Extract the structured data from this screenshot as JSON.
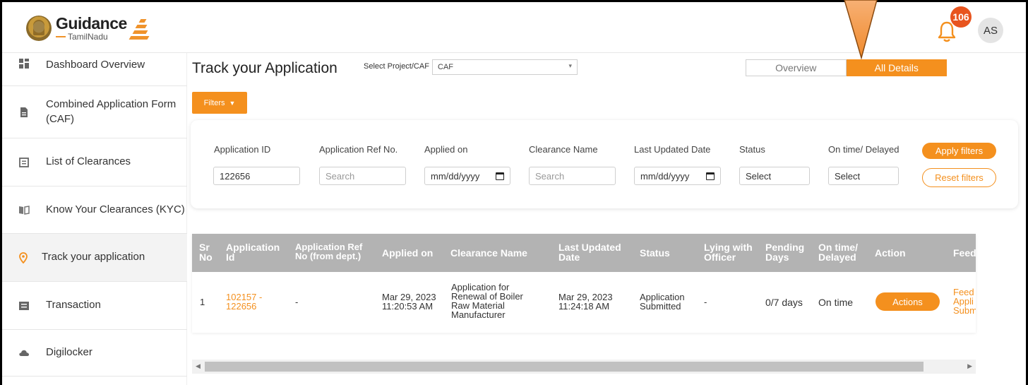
{
  "header": {
    "logo": {
      "title": "Guidance",
      "subtitle": "TamilNadu"
    },
    "notifications": {
      "count": "106"
    },
    "user": {
      "initials": "AS"
    }
  },
  "sidebar": {
    "items": [
      {
        "label": "Dashboard Overview",
        "icon": "dashboard-icon"
      },
      {
        "label": "Combined Application Form (CAF)",
        "icon": "document-icon"
      },
      {
        "label": "List of Clearances",
        "icon": "list-icon"
      },
      {
        "label": "Know Your Clearances (KYC)",
        "icon": "book-icon"
      },
      {
        "label": "Track your application",
        "icon": "location-pin-icon",
        "active": true
      },
      {
        "label": "Transaction",
        "icon": "transaction-icon"
      },
      {
        "label": "Digilocker",
        "icon": "cloud-icon"
      }
    ]
  },
  "main": {
    "title": "Track your Application",
    "project_label": "Select Project/CAF",
    "project_value": "CAF",
    "view_toggle": {
      "overview": "Overview",
      "all_details": "All Details",
      "selected": "All Details"
    },
    "filters_button": "Filters"
  },
  "filters": {
    "application_id": {
      "label": "Application ID",
      "value": "122656"
    },
    "application_ref": {
      "label": "Application Ref No.",
      "placeholder": "Search"
    },
    "applied_on": {
      "label": "Applied on",
      "placeholder": "mm/dd/yyyy"
    },
    "clearance_name": {
      "label": "Clearance Name",
      "placeholder": "Search"
    },
    "last_updated": {
      "label": "Last Updated Date",
      "placeholder": "mm/dd/yyyy"
    },
    "status": {
      "label": "Status",
      "value": "Select"
    },
    "ontime": {
      "label": "On time/ Delayed",
      "value": "Select"
    },
    "apply_label": "Apply filters",
    "reset_label": "Reset filters"
  },
  "table": {
    "headers": {
      "sr": [
        "Sr",
        "No"
      ],
      "app_id": [
        "Application",
        "Id"
      ],
      "ref": [
        "Application Ref",
        "No (from dept.)"
      ],
      "applied": "Applied on",
      "clearance": "Clearance Name",
      "updated": [
        "Last Updated",
        "Date"
      ],
      "status": "Status",
      "officer": [
        "Lying with",
        "Officer"
      ],
      "pending": [
        "Pending",
        "Days"
      ],
      "ontime": [
        "On time/",
        "Delayed"
      ],
      "action": "Action",
      "feedback": "Feed"
    },
    "row": {
      "sr": "1",
      "app_id": [
        "102157 -",
        "122656"
      ],
      "ref": "-",
      "applied": [
        "Mar 29, 2023",
        "11:20:53 AM"
      ],
      "clearance": [
        "Application for",
        "Renewal of Boiler",
        "Raw Material",
        "Manufacturer"
      ],
      "updated": [
        "Mar 29, 2023",
        "11:24:18 AM"
      ],
      "status": [
        "Application",
        "Submitted"
      ],
      "officer": "-",
      "pending": "0/7 days",
      "ontime": "On time",
      "action_label": "Actions",
      "feedback": [
        "Feed",
        "Appli",
        "Subm"
      ]
    }
  },
  "colors": {
    "accent": "#f4901e",
    "header_bg": "#b3b3b3",
    "badge": "#e8541e"
  }
}
